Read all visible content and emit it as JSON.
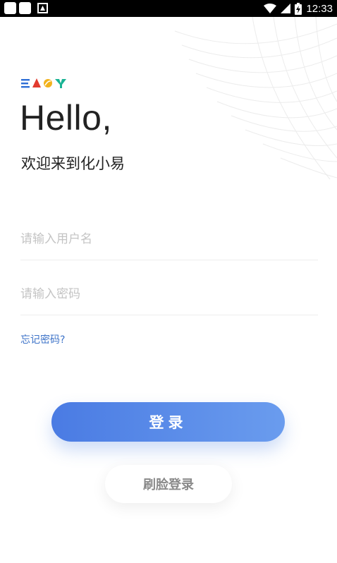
{
  "status_bar": {
    "time": "12:33",
    "icons": [
      "notification-square-icon",
      "notification-square-icon",
      "font-a-icon",
      "wifi-icon",
      "signal-icon",
      "battery-charging-icon"
    ]
  },
  "logo": {
    "text": "EASY",
    "colors": [
      "#2f6fd6",
      "#e23b2f",
      "#f2b21c",
      "#1ab394"
    ]
  },
  "greeting": "Hello,",
  "welcome": "欢迎来到化小易",
  "username": {
    "placeholder": "请输入用户名",
    "value": ""
  },
  "password": {
    "placeholder": "请输入密码",
    "value": ""
  },
  "forgot_password": "忘记密码?",
  "login_button": "登录",
  "face_login_button": "刷脸登录",
  "colors": {
    "accent": "#4a7be3",
    "link": "#3d73c8"
  }
}
